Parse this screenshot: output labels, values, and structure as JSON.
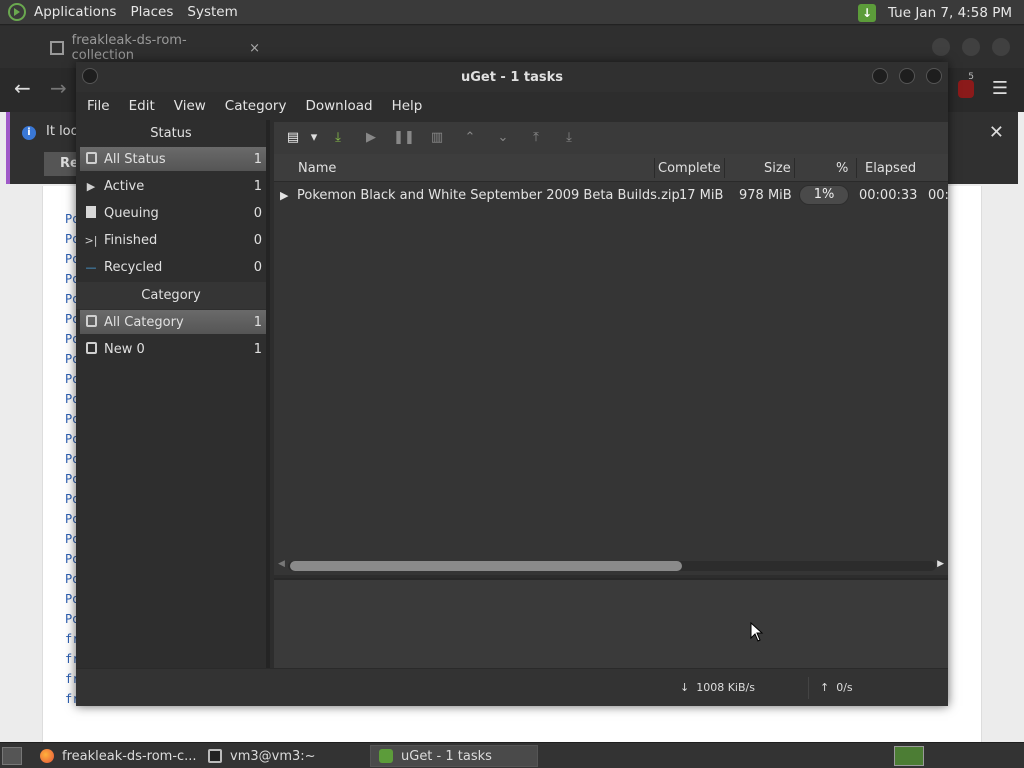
{
  "top_panel": {
    "menus": [
      "Applications",
      "Places",
      "System"
    ],
    "clock": "Tue Jan  7,  4:58 PM"
  },
  "browser": {
    "tab_title": "freakleak-ds-rom-collection",
    "info_text": "It look",
    "info_button": "Ref",
    "addon_badge": "5",
    "page_lines": [
      "Po",
      "Po",
      "Po",
      "Po",
      "Po",
      "Po",
      "Po",
      "Po",
      "Po",
      "Po",
      "Po",
      "Po",
      "Po",
      "Po",
      "Po",
      "Po",
      "Po",
      "Po",
      "Po",
      "Po",
      "Po",
      "fr",
      "fr",
      "fr",
      "fr"
    ]
  },
  "uget": {
    "title": "uGet - 1 tasks",
    "menu": [
      "File",
      "Edit",
      "View",
      "Category",
      "Download",
      "Help"
    ],
    "sidebar": {
      "status_header": "Status",
      "status_items": [
        {
          "label": "All Status",
          "count": "1",
          "icon": "all-status-icon"
        },
        {
          "label": "Active",
          "count": "1",
          "icon": "active-icon"
        },
        {
          "label": "Queuing",
          "count": "0",
          "icon": "queuing-icon"
        },
        {
          "label": "Finished",
          "count": "0",
          "icon": "finished-icon"
        },
        {
          "label": "Recycled",
          "count": "0",
          "icon": "recycled-icon"
        }
      ],
      "category_header": "Category",
      "category_items": [
        {
          "label": "All Category",
          "count": "1"
        },
        {
          "label": "New 0",
          "count": "1"
        }
      ]
    },
    "columns": [
      "Name",
      "Complete",
      "Size",
      "%",
      "Elapsed"
    ],
    "task": {
      "name": "Pokemon Black and White September 2009 Beta Builds.zip",
      "complete": "17 MiB",
      "size": "978 MiB",
      "percent": "1%",
      "progress_fraction": 0.01,
      "elapsed": "00:00:33",
      "overflow": "00:"
    },
    "status": {
      "down_speed": "1008 KiB/s",
      "up_speed": "0/s"
    }
  },
  "taskbar": {
    "items": [
      {
        "label": "freakleak-ds-rom-c...",
        "icon": "firefox-icon"
      },
      {
        "label": "vm3@vm3:~",
        "icon": "terminal-icon"
      },
      {
        "label": "uGet - 1 tasks",
        "icon": "uget-icon"
      }
    ]
  },
  "colors": {
    "accent_green": "#5c9c3a",
    "selection": "#5f5f5f"
  }
}
